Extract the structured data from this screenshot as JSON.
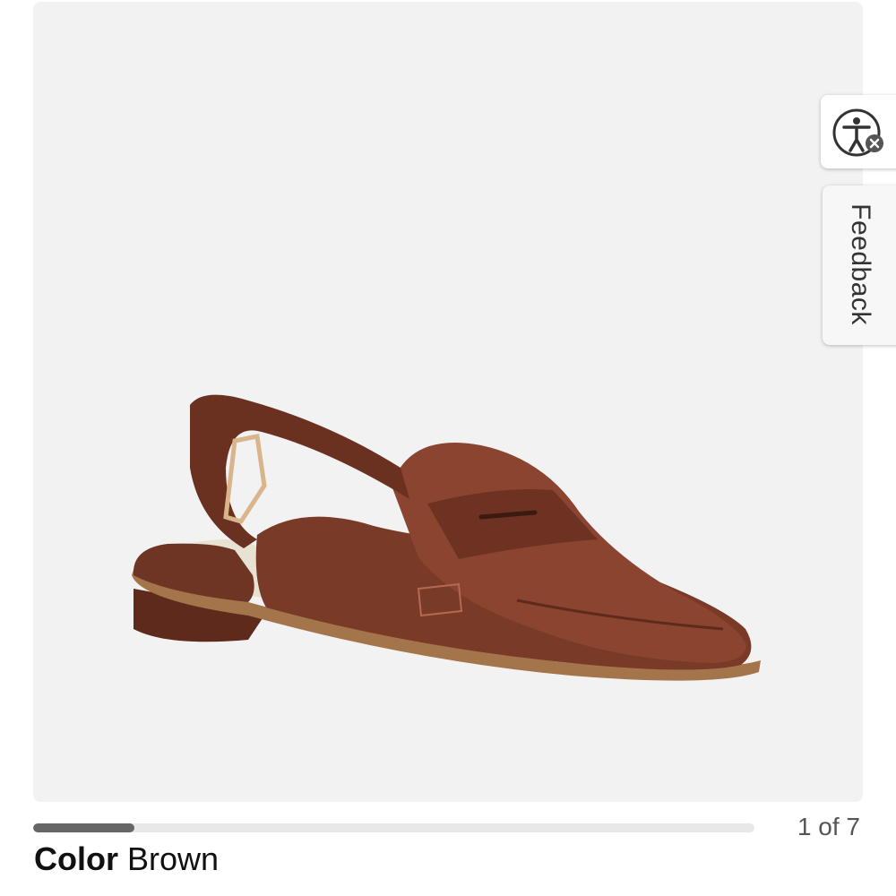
{
  "gallery": {
    "image_subject": "shoe-image",
    "current": 1,
    "total": 7,
    "progress_fraction": 0.14,
    "counter_text": "1 of 7"
  },
  "side_tabs": {
    "accessibility_icon": "accessibility-icon",
    "feedback_label": "Feedback"
  },
  "product": {
    "color_label": "Color",
    "color_value": "Brown"
  },
  "colors": {
    "image_bg": "#f2f2f2",
    "progress_fill": "#666666",
    "progress_track": "#e8e8e8",
    "shoe_leather": "#7a3a28",
    "sole": "#8b5a3a"
  }
}
